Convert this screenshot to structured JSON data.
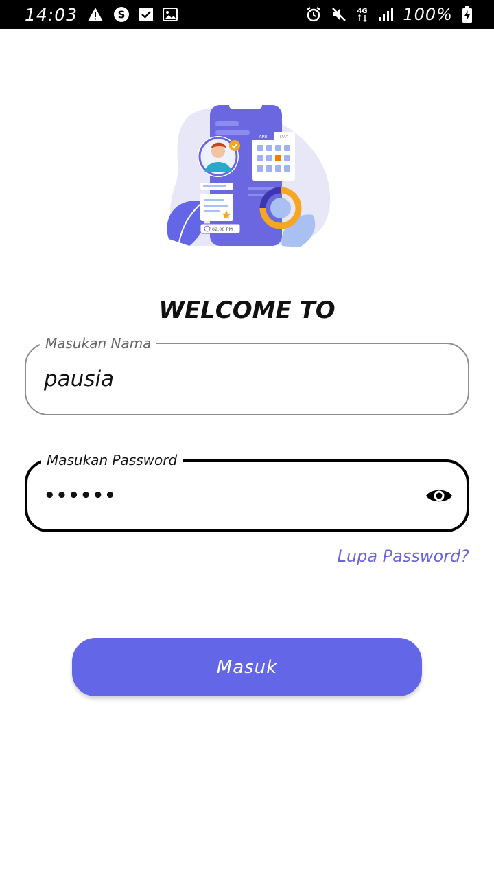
{
  "status_bar": {
    "time": "14:03",
    "battery": "100%",
    "network": "4G",
    "left_icons": [
      "warning-icon",
      "skype-icon",
      "checkbox-icon",
      "image-icon"
    ],
    "right_icons": [
      "alarm-icon",
      "mute-icon",
      "network-4g-icon",
      "signal-icon",
      "battery-charging-icon"
    ]
  },
  "illustration": {
    "calendar_months": [
      "APR",
      "MAY"
    ],
    "time_label": "02:00 PM",
    "colors": {
      "primary": "#6366e6",
      "accent_orange": "#f5a623",
      "light_purple": "#e6e6f8"
    }
  },
  "login": {
    "heading": "WELCOME TO",
    "name_label": "Masukan Nama",
    "name_value": "pausia",
    "password_label": "Masukan Password",
    "password_value": "••••••",
    "forgot_password": "Lupa Password?",
    "submit_label": "Masuk"
  },
  "colors": {
    "button": "#6366e6",
    "link": "#6a66d9",
    "focused_border": "#000000",
    "idle_border": "#8e8e8e"
  }
}
